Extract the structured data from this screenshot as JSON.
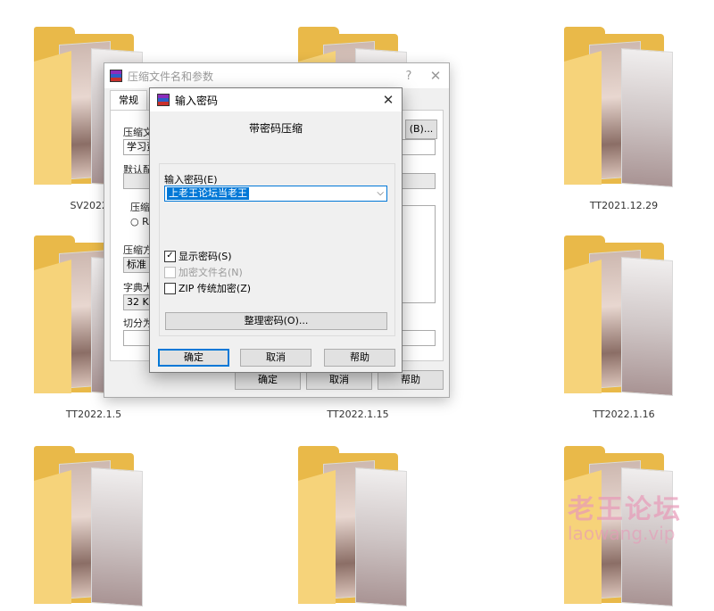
{
  "desktop": {
    "folders": [
      {
        "label": "SV2022..."
      },
      {
        "label": ""
      },
      {
        "label": "TT2021.12.29"
      },
      {
        "label": "TT2022.1.5"
      },
      {
        "label": "TT2022.1.15"
      },
      {
        "label": "TT2022.1.16"
      },
      {
        "label": ""
      },
      {
        "label": ""
      },
      {
        "label": ""
      }
    ]
  },
  "back_dialog": {
    "title": "压缩文件名和参数",
    "help_glyph": "?",
    "close_glyph": "✕",
    "tab_general": "常规",
    "archive_name_label": "压缩文",
    "archive_name_value": "学习资",
    "browse_button": "(B)...",
    "default_profile_label": "默认配",
    "format_group_label": "压缩",
    "format_rar": "RA",
    "method_label": "压缩方",
    "method_value": "标准",
    "dict_label": "字典大",
    "dict_value": "32 KB",
    "split_label": "切分为",
    "ok_button": "确定",
    "cancel_button": "取消",
    "help_button": "帮助"
  },
  "password_dialog": {
    "title": "输入密码",
    "close_glyph": "✕",
    "heading": "带密码压缩",
    "password_label": "输入密码(E)",
    "password_value": "上老王论坛当老王",
    "show_password": {
      "label": "显示密码(S)",
      "checked": true
    },
    "encrypt_filenames": {
      "label": "加密文件名(N)",
      "checked": false,
      "disabled": true
    },
    "zip_legacy": {
      "label": "ZIP 传统加密(Z)",
      "checked": false
    },
    "organize_button": "整理密码(O)...",
    "ok_button": "确定",
    "cancel_button": "取消",
    "help_button": "帮助"
  },
  "watermark": {
    "text": "老王论坛",
    "url": "laowang.vip"
  },
  "colors": {
    "folder": "#e9b949",
    "accent": "#0078d7",
    "dialog_bg": "#f0f0f0"
  }
}
